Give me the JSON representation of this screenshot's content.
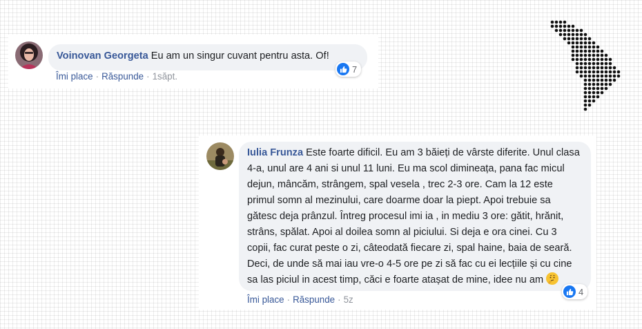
{
  "comments": [
    {
      "author": "Voinovan Georgeta",
      "text": "Eu am un singur cuvant pentru asta. Of!",
      "reactions_count": "7",
      "actions": {
        "like": "Îmi place",
        "reply": "Răspunde",
        "separator": "·",
        "time": "1săpt."
      }
    },
    {
      "author": "Iulia Frunza",
      "text": "Este foarte dificil. Eu am 3 băieți de vârste diferite. Unul clasa 4-a, unul are 4 ani si unul 11 luni. Eu ma scol dimineața, pana fac micul dejun, mâncăm, strângem, spal vesela , trec 2-3 ore. Cam la 12 este primul somn al mezinului, care doarme doar la piept. Apoi trebuie sa gătesc deja prânzul. Întreg procesul imi ia , in mediu 3 ore: gătit, hrănit, strâns, spălat. Apoi al doilea somn al piciului. Si deja e ora cinei. Cu 3 copii, fac curat peste o zi, câteodată fiecare zi, spal haine, baia de seară. Deci, de unde să mai iau vre-o 4-5 ore pe zi să fac cu ei lecțiile și cu cine sa las piciul in acest timp, căci e foarte atașat de mine, idee nu am",
      "reactions_count": "4",
      "actions": {
        "like": "Îmi place",
        "reply": "Răspunde",
        "separator": "·",
        "time": "5z"
      }
    }
  ],
  "icons": {
    "reaction": "like-thumb-icon",
    "emoji": "thinking-face-emoji",
    "decoration": "dotted-moldova-map-icon"
  },
  "colors": {
    "author": "#385898",
    "like_badge": "#1877f2",
    "bubble": "#f0f2f5",
    "meta": "#90949c"
  }
}
